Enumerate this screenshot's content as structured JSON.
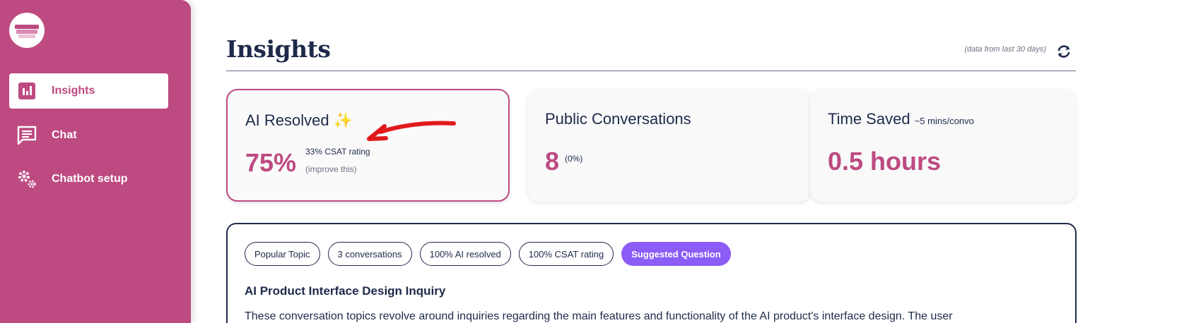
{
  "sidebar": {
    "logo": "app-logo",
    "items": [
      {
        "label": "Insights",
        "icon": "bar-chart-icon",
        "active": true
      },
      {
        "label": "Chat",
        "icon": "chat-bubble-icon",
        "active": false
      },
      {
        "label": "Chatbot setup",
        "icon": "gears-icon",
        "active": false
      }
    ]
  },
  "header": {
    "title": "Insights",
    "data_note": "(data from last 30 days)",
    "refresh_icon": "refresh-icon"
  },
  "cards": {
    "ai_resolved": {
      "title": "AI Resolved",
      "emoji": "✨",
      "value": "75%",
      "csat": "33% CSAT rating",
      "improve": "(improve this)"
    },
    "public_conversations": {
      "title": "Public Conversations",
      "value": "8",
      "pct": "(0%)"
    },
    "time_saved": {
      "title": "Time Saved",
      "subtitle": "~5 mins/convo",
      "value": "0.5 hours"
    }
  },
  "topic": {
    "tags": [
      "Popular Topic",
      "3 conversations",
      "100% AI resolved",
      "100% CSAT rating"
    ],
    "suggested_label": "Suggested Question",
    "title": "AI Product Interface Design Inquiry",
    "description": "These conversation topics revolve around inquiries regarding the main features and functionality of the AI product's interface design. The user"
  },
  "colors": {
    "brand": "#bd4a80",
    "navy": "#1e2a4a",
    "suggested": "#8b5cf6",
    "annotation": "#e0191b"
  }
}
